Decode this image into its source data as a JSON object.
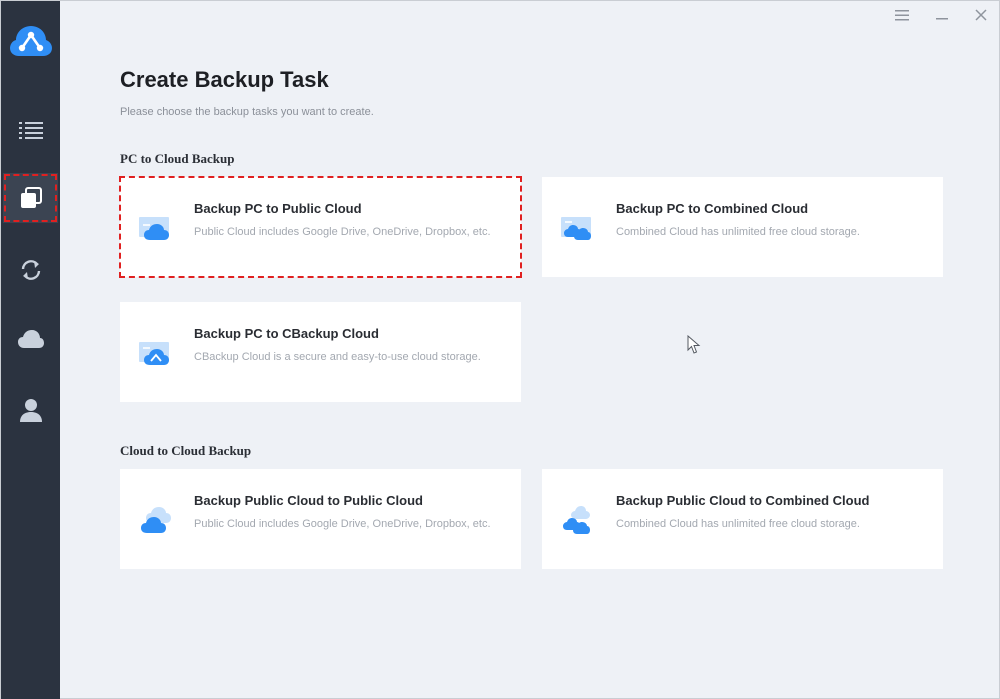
{
  "sidebar": {
    "items": [
      {
        "icon": "list-icon"
      },
      {
        "icon": "copy-task-icon",
        "active": true
      },
      {
        "icon": "sync-icon"
      },
      {
        "icon": "cloud-icon"
      },
      {
        "icon": "user-icon"
      }
    ]
  },
  "titlebar": {
    "menu_icon": "menu-icon",
    "minimize_icon": "minimize-icon",
    "close_icon": "close-icon"
  },
  "main": {
    "title": "Create Backup Task",
    "subtitle": "Please choose the backup tasks you want to create.",
    "sections": [
      {
        "title": "PC to Cloud Backup",
        "cards": [
          {
            "title": "Backup PC to Public Cloud",
            "desc": "Public Cloud includes Google Drive, OneDrive, Dropbox, etc.",
            "selected": true
          },
          {
            "title": "Backup PC to Combined Cloud",
            "desc": "Combined Cloud has unlimited free cloud storage."
          },
          {
            "title": "Backup PC to CBackup Cloud",
            "desc": "CBackup Cloud is a secure and easy-to-use cloud storage."
          }
        ]
      },
      {
        "title": "Cloud to Cloud Backup",
        "cards": [
          {
            "title": "Backup Public Cloud to Public Cloud",
            "desc": "Public Cloud includes Google Drive, OneDrive, Dropbox, etc."
          },
          {
            "title": "Backup Public Cloud to Combined Cloud",
            "desc": "Combined Cloud has unlimited free cloud storage."
          }
        ]
      }
    ]
  },
  "colors": {
    "sidebar_bg": "#2b3340",
    "accent_blue": "#2f8ef5",
    "selection_red": "#e02020",
    "page_bg": "#eef1f6"
  }
}
